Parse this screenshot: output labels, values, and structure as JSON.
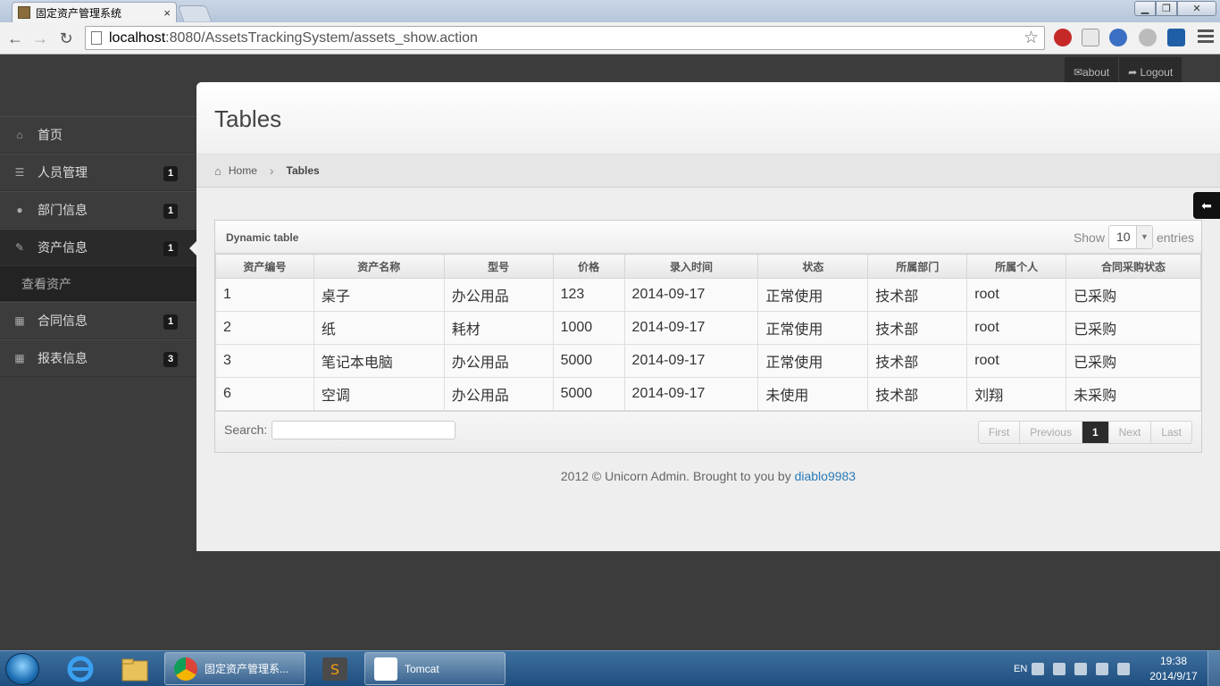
{
  "browser": {
    "tab_title": "固定资产管理系统",
    "tab_close": "×",
    "url_host": "localhost",
    "url_path": ":8080/AssetsTrackingSystem/assets_show.action"
  },
  "topnav": {
    "about": "✉about",
    "logout": "➦ Logout"
  },
  "sidebar": {
    "items": [
      {
        "label": "首页",
        "icon": "home-icon",
        "glyph": "⌂",
        "badge": ""
      },
      {
        "label": "人员管理",
        "icon": "list-icon",
        "glyph": "☰",
        "badge": "1"
      },
      {
        "label": "部门信息",
        "icon": "tint-icon",
        "glyph": "●",
        "badge": "1"
      },
      {
        "label": "资产信息",
        "icon": "pencil-icon",
        "glyph": "✎",
        "badge": "1"
      },
      {
        "label": "合同信息",
        "icon": "grid-icon",
        "glyph": "▦",
        "badge": "1"
      },
      {
        "label": "报表信息",
        "icon": "grid-icon",
        "glyph": "▦",
        "badge": "3"
      }
    ],
    "submenu_label": "查看资产"
  },
  "page": {
    "title": "Tables",
    "breadcrumb_home": "Home",
    "breadcrumb_current": "Tables"
  },
  "table_widget": {
    "title": "Dynamic table",
    "show_label": "Show",
    "entries_value": "10",
    "entries_label": "entries",
    "columns": [
      "资产编号",
      "资产名称",
      "型号",
      "价格",
      "录入时间",
      "状态",
      "所属部门",
      "所属个人",
      "合同采购状态"
    ],
    "rows": [
      [
        "1",
        "桌子",
        "办公用品",
        "123",
        "2014-09-17",
        "正常使用",
        "技术部",
        "root",
        "已采购"
      ],
      [
        "2",
        "纸",
        "耗材",
        "1000",
        "2014-09-17",
        "正常使用",
        "技术部",
        "root",
        "已采购"
      ],
      [
        "3",
        "笔记本电脑",
        "办公用品",
        "5000",
        "2014-09-17",
        "正常使用",
        "技术部",
        "root",
        "已采购"
      ],
      [
        "6",
        "空调",
        "办公用品",
        "5000",
        "2014-09-17",
        "未使用",
        "技术部",
        "刘翔",
        "未采购"
      ]
    ],
    "search_label": "Search:",
    "pagination": {
      "first": "First",
      "previous": "Previous",
      "current": "1",
      "next": "Next",
      "last": "Last"
    }
  },
  "footer": {
    "text": "2012 © Unicorn Admin. Brought to you by ",
    "link": "diablo9983"
  },
  "taskbar": {
    "tasks": [
      {
        "label": "固定资产管理系...",
        "icon": "chrome-icon"
      },
      {
        "label": "Tomcat",
        "icon": "java-icon"
      }
    ],
    "lang": "EN",
    "time": "19:38",
    "date": "2014/9/17"
  }
}
